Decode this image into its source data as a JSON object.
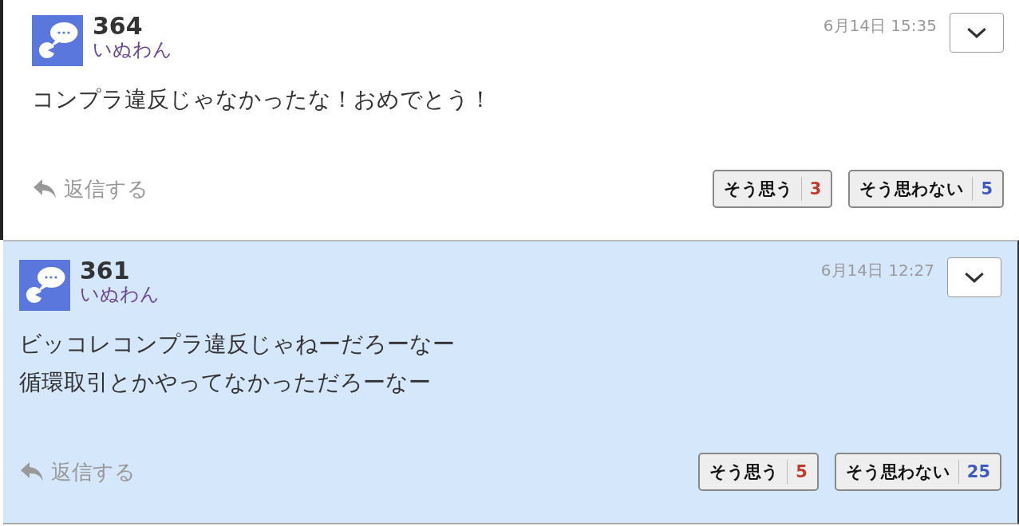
{
  "comments": [
    {
      "number": "364",
      "author": "いぬわん",
      "time": "6月14日 15:35",
      "lines": [
        "コンプラ違反じゃなかったな！おめでとう！"
      ],
      "highlighted": false,
      "reply": "返信する",
      "agree": {
        "label": "そう思う",
        "count": "3"
      },
      "disagree": {
        "label": "そう思わない",
        "count": "5"
      }
    },
    {
      "number": "361",
      "author": "いぬわん",
      "time": "6月14日 12:27",
      "lines": [
        "ビッコレコンプラ違反じゃねーだろーなー",
        "循環取引とかやってなかっただろーなー"
      ],
      "highlighted": true,
      "reply": "返信する",
      "agree": {
        "label": "そう思う",
        "count": "5"
      },
      "disagree": {
        "label": "そう思わない",
        "count": "25"
      }
    }
  ]
}
